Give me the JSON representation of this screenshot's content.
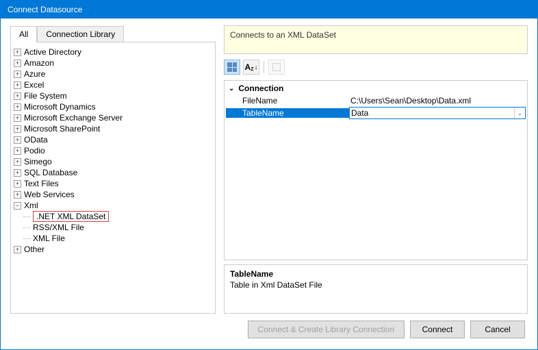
{
  "window": {
    "title": "Connect Datasource"
  },
  "tabs": {
    "all": "All",
    "library": "Connection Library"
  },
  "tree": {
    "items": [
      {
        "label": "Active Directory",
        "exp": "+"
      },
      {
        "label": "Amazon",
        "exp": "+"
      },
      {
        "label": "Azure",
        "exp": "+"
      },
      {
        "label": "Excel",
        "exp": "+"
      },
      {
        "label": "File System",
        "exp": "+"
      },
      {
        "label": "Microsoft Dynamics",
        "exp": "+"
      },
      {
        "label": "Microsoft Exchange Server",
        "exp": "+"
      },
      {
        "label": "Microsoft SharePoint",
        "exp": "+"
      },
      {
        "label": "OData",
        "exp": "+"
      },
      {
        "label": "Podio",
        "exp": "+"
      },
      {
        "label": "Simego",
        "exp": "+"
      },
      {
        "label": "SQL Database",
        "exp": "+"
      },
      {
        "label": "Text Files",
        "exp": "+"
      },
      {
        "label": "Web Services",
        "exp": "+"
      }
    ],
    "xml": {
      "label": "Xml",
      "exp": "−",
      "children": [
        {
          "label": ".NET XML DataSet",
          "highlighted": true
        },
        {
          "label": "RSS/XML File"
        },
        {
          "label": "XML File"
        }
      ]
    },
    "other": {
      "label": "Other",
      "exp": "+"
    }
  },
  "info": {
    "text": "Connects to an XML DataSet"
  },
  "propgrid": {
    "header": "Connection",
    "rows": [
      {
        "name": "FileName",
        "value": "C:\\Users\\Sean\\Desktop\\Data.xml"
      },
      {
        "name": "TableName",
        "value": "Data",
        "selected": true
      }
    ]
  },
  "description": {
    "title": "TableName",
    "text": "Table in Xml DataSet File"
  },
  "buttons": {
    "create": "Connect & Create Library Connection",
    "connect": "Connect",
    "cancel": "Cancel"
  },
  "sort": {
    "az": "A",
    "z": "Z"
  }
}
